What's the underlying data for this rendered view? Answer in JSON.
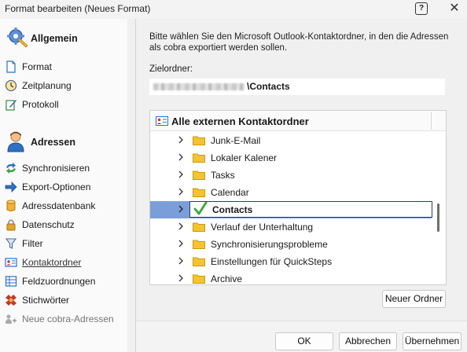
{
  "window": {
    "title": "Format bearbeiten (Neues Format)",
    "help_label": "?",
    "close_label": "✕"
  },
  "sidebar": {
    "sections": [
      {
        "title": "Allgemein",
        "icon": "gear-tools-icon",
        "items": [
          {
            "label": "Format",
            "icon": "document-icon"
          },
          {
            "label": "Zeitplanung",
            "icon": "clock-icon"
          },
          {
            "label": "Protokoll",
            "icon": "pen-notepad-icon"
          }
        ]
      },
      {
        "title": "Adressen",
        "icon": "person-icon",
        "items": [
          {
            "label": "Synchronisieren",
            "icon": "sync-icon"
          },
          {
            "label": "Export-Optionen",
            "icon": "arrow-right-icon"
          },
          {
            "label": "Adressdatenbank",
            "icon": "database-icon"
          },
          {
            "label": "Datenschutz",
            "icon": "padlock-icon"
          },
          {
            "label": "Filter",
            "icon": "filter-icon"
          },
          {
            "label": "Kontaktordner",
            "icon": "contact-card-icon",
            "active": true
          },
          {
            "label": "Feldzuordnungen",
            "icon": "table-grid-icon"
          },
          {
            "label": "Stichwörter",
            "icon": "keyword-tag-icon"
          },
          {
            "label": "Neue cobra-Adressen",
            "icon": "add-contacts-icon",
            "disabled": true
          }
        ]
      }
    ]
  },
  "main": {
    "intro_text": "Bitte wählen Sie den Microsoft Outlook-Kontaktordner, in den die Adressen als cobra exportiert werden sollen.",
    "target_label": "Zielordner:",
    "target_value": "\\Contacts",
    "tree": {
      "header": "Alle externen Kontaktordner",
      "nodes": [
        {
          "label": "Junk-E-Mail"
        },
        {
          "label": "Lokaler Kalener"
        },
        {
          "label": "Tasks"
        },
        {
          "label": "Calendar"
        },
        {
          "label": "Contacts",
          "selected": true
        },
        {
          "label": "Verlauf der Unterhaltung"
        },
        {
          "label": "Synchronisierungsprobleme"
        },
        {
          "label": "Einstellungen für QuickSteps"
        },
        {
          "label": "Archive"
        }
      ]
    },
    "new_folder_label": "Neuer Ordner"
  },
  "footer": {
    "ok_label": "OK",
    "cancel_label": "Abbrechen",
    "apply_label": "Übernehmen"
  },
  "colors": {
    "selection_fill": "#7c9ed8",
    "selection_border": "#1e3c8a",
    "folder_yellow": "#f4c430",
    "check_green": "#3aa63a"
  }
}
